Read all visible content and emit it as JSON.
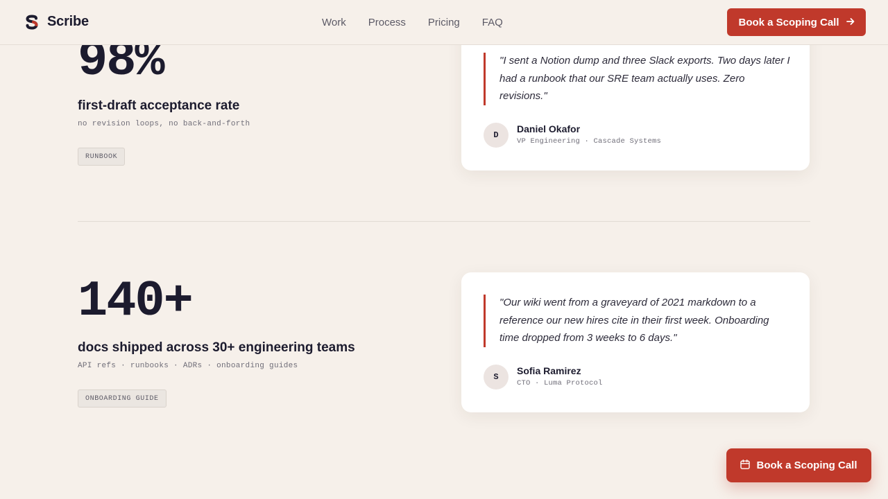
{
  "nav": {
    "brand": "Scribe",
    "links": [
      "Work",
      "Process",
      "Pricing",
      "FAQ"
    ],
    "cta_label": "Book a Scoping Call"
  },
  "stats": [
    {
      "number": "98%",
      "label": "first-draft acceptance rate",
      "sub": "no revision loops, no back-and-forth",
      "tag": "RUNBOOK",
      "testimonial": {
        "quote": "\"I sent a Notion dump and three Slack exports. Two days later I had a runbook that our SRE team actually uses. Zero revisions.\"",
        "initial": "D",
        "name": "Daniel Okafor",
        "role": "VP Engineering · Cascade Systems"
      }
    },
    {
      "number": "140+",
      "label": "docs shipped across 30+ engineering teams",
      "sub": "API refs · runbooks · ADRs · onboarding guides",
      "tag": "ONBOARDING GUIDE",
      "testimonial": {
        "quote": "\"Our wiki went from a graveyard of 2021 markdown to a reference our new hires cite in their first week. Onboarding time dropped from 3 weeks to 6 days.\"",
        "initial": "S",
        "name": "Sofia Ramirez",
        "role": "CTO · Luma Protocol"
      }
    }
  ],
  "floating_cta": {
    "label": "Book a Scoping Call",
    "icon": "calendar-icon"
  },
  "colors": {
    "accent": "#c0392b",
    "background": "#f6f0ea",
    "text": "#1c1b2e"
  }
}
